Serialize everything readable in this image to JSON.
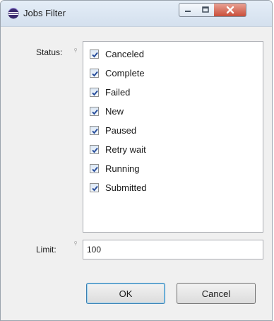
{
  "window": {
    "title": "Jobs Filter",
    "icon": "eclipse-icon"
  },
  "status": {
    "label": "Status:",
    "items": [
      {
        "label": "Canceled",
        "checked": true
      },
      {
        "label": "Complete",
        "checked": true
      },
      {
        "label": "Failed",
        "checked": true
      },
      {
        "label": "New",
        "checked": true
      },
      {
        "label": "Paused",
        "checked": true
      },
      {
        "label": "Retry wait",
        "checked": true
      },
      {
        "label": "Running",
        "checked": true
      },
      {
        "label": "Submitted",
        "checked": true
      }
    ]
  },
  "limit": {
    "label": "Limit:",
    "value": "100"
  },
  "buttons": {
    "ok": "OK",
    "cancel": "Cancel"
  },
  "colors": {
    "checkmark": "#2a4f9c",
    "titlebar": "#dbe6f3",
    "close": "#c94f3b"
  }
}
